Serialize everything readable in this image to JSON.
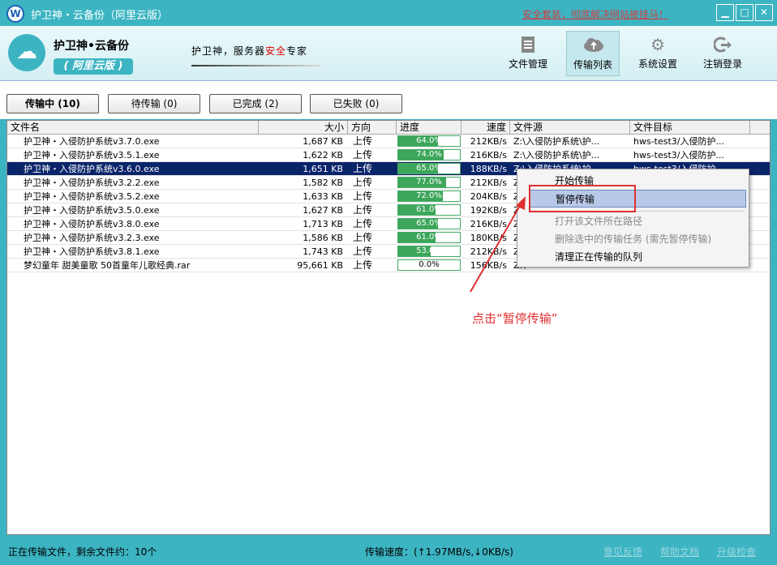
{
  "window": {
    "title": "护卫神・云备份（阿里云版）",
    "promo": "安全套装，彻底解决网站被挂马！",
    "controls": {
      "minimize": "▁",
      "maximize": "□",
      "close": "✕"
    }
  },
  "header": {
    "brand": "护卫神•云备份",
    "edition": "( 阿里云版 )",
    "slogan_pre": "护卫神，服务器",
    "slogan_hl": "安全",
    "slogan_post": "专家",
    "toolbar": [
      {
        "label": "文件管理",
        "icon": "document-icon"
      },
      {
        "label": "传输列表",
        "icon": "cloud-upload-icon"
      },
      {
        "label": "系统设置",
        "icon": "gear-icon"
      },
      {
        "label": "注销登录",
        "icon": "logout-icon"
      }
    ]
  },
  "tabs": [
    {
      "label": "传输中 (10)"
    },
    {
      "label": "待传输 (0)"
    },
    {
      "label": "已完成 (2)"
    },
    {
      "label": "已失败 (0)"
    }
  ],
  "columns": [
    "文件名",
    "大小",
    "方向",
    "进度",
    "速度",
    "文件源",
    "文件目标"
  ],
  "rows": [
    {
      "name": "护卫神・入侵防护系统v3.7.0.exe",
      "size": "1,687 KB",
      "dir": "上传",
      "progress": 64.0,
      "progress_label": "64.0%",
      "speed": "212KB/s",
      "src": "Z:\\入侵防护系统\\护...",
      "dst": "hws-test3/入侵防护..."
    },
    {
      "name": "护卫神・入侵防护系统v3.5.1.exe",
      "size": "1,622 KB",
      "dir": "上传",
      "progress": 74.0,
      "progress_label": "74.0%",
      "speed": "216KB/s",
      "src": "Z:\\入侵防护系统\\护...",
      "dst": "hws-test3/入侵防护..."
    },
    {
      "name": "护卫神・入侵防护系统v3.6.0.exe",
      "size": "1,651 KB",
      "dir": "上传",
      "progress": 65.0,
      "progress_label": "65.0%",
      "speed": "188KB/s",
      "src": "Z:\\入侵防护系统\\护",
      "dst": "hws-test3/入侵防护"
    },
    {
      "name": "护卫神・入侵防护系统v3.2.2.exe",
      "size": "1,582 KB",
      "dir": "上传",
      "progress": 77.0,
      "progress_label": "77.0%",
      "speed": "212KB/s",
      "src": "Z:\\",
      "dst": ""
    },
    {
      "name": "护卫神・入侵防护系统v3.5.2.exe",
      "size": "1,633 KB",
      "dir": "上传",
      "progress": 72.0,
      "progress_label": "72.0%",
      "speed": "204KB/s",
      "src": "Z:\\",
      "dst": ""
    },
    {
      "name": "护卫神・入侵防护系统v3.5.0.exe",
      "size": "1,627 KB",
      "dir": "上传",
      "progress": 61.0,
      "progress_label": "61.0%",
      "speed": "192KB/s",
      "src": "Z:\\",
      "dst": ""
    },
    {
      "name": "护卫神・入侵防护系统v3.8.0.exe",
      "size": "1,713 KB",
      "dir": "上传",
      "progress": 65.0,
      "progress_label": "65.0%",
      "speed": "216KB/s",
      "src": "Z:\\",
      "dst": ""
    },
    {
      "name": "护卫神・入侵防护系统v3.2.3.exe",
      "size": "1,586 KB",
      "dir": "上传",
      "progress": 61.0,
      "progress_label": "61.0%",
      "speed": "180KB/s",
      "src": "Z:\\",
      "dst": ""
    },
    {
      "name": "护卫神・入侵防护系统v3.8.1.exe",
      "size": "1,743 KB",
      "dir": "上传",
      "progress": 53.0,
      "progress_label": "53.0%",
      "speed": "212KB/s",
      "src": "Z:\\",
      "dst": ""
    },
    {
      "name": "梦幻童年 甜美童歌 50首童年儿歌经典.rar",
      "size": "95,661 KB",
      "dir": "上传",
      "progress": 0.0,
      "progress_label": "0.0%",
      "speed": "156KB/s",
      "src": "Z:\\",
      "dst": ""
    }
  ],
  "context_menu": [
    {
      "label": "开始传输",
      "enabled": true
    },
    {
      "label": "暂停传输",
      "enabled": true,
      "highlighted": true
    },
    {
      "label": "打开该文件所在路径",
      "enabled": false
    },
    {
      "label": "删除选中的传输任务 (需先暂停传输)",
      "enabled": false
    },
    {
      "label": "清理正在传输的队列",
      "enabled": true
    }
  ],
  "annotation": "点击“暂停传输”",
  "status": {
    "left": "正在传输文件，剩余文件约：10个",
    "speed": "传输速度：(↑1.97MB/s,↓0KB/s)",
    "links": [
      "意见反馈",
      "帮助文档",
      "升级检查"
    ]
  },
  "colors": {
    "accent": "#3cb4c2",
    "selection": "#0a246a",
    "progress": "#3ca65a",
    "annotation": "#e03030"
  }
}
